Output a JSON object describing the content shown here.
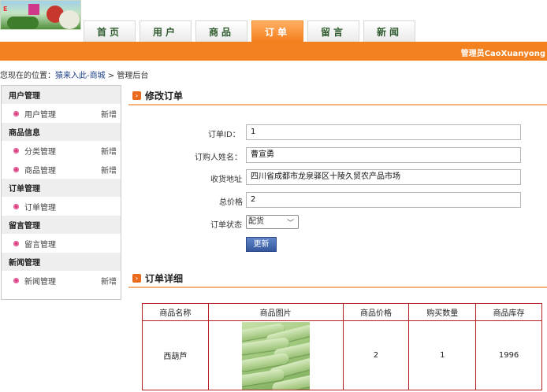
{
  "header": {
    "logo_icon": "vegetable-logo",
    "nav": [
      {
        "label": "首页",
        "active": false
      },
      {
        "label": "用户",
        "active": false
      },
      {
        "label": "商品",
        "active": false
      },
      {
        "label": "订单",
        "active": true
      },
      {
        "label": "留言",
        "active": false
      },
      {
        "label": "新闻",
        "active": false
      }
    ],
    "admin_text": "管理员CaoXuanyong",
    "accent_color": "#f4811f"
  },
  "breadcrumb": {
    "prefix": "您现在的位置：",
    "link": "猿来入此-商城",
    "separator": " > ",
    "current": "管理后台"
  },
  "sidebar": {
    "groups": [
      {
        "title": "用户管理",
        "items": [
          {
            "label": "用户管理",
            "extra": "新增"
          }
        ]
      },
      {
        "title": "商品信息",
        "items": [
          {
            "label": "分类管理",
            "extra": "新增"
          },
          {
            "label": "商品管理",
            "extra": "新增"
          }
        ]
      },
      {
        "title": "订单管理",
        "items": [
          {
            "label": "订单管理",
            "extra": ""
          }
        ]
      },
      {
        "title": "留言管理",
        "items": [
          {
            "label": "留言管理",
            "extra": ""
          }
        ]
      },
      {
        "title": "新闻管理",
        "items": [
          {
            "label": "新闻管理",
            "extra": "新增"
          }
        ]
      }
    ]
  },
  "edit": {
    "title": "修改订单",
    "fields": {
      "order_id": {
        "label": "订单ID：",
        "value": "1"
      },
      "buyer": {
        "label": "订购人姓名：",
        "value": "曹宣勇"
      },
      "address": {
        "label": "收货地址",
        "value": "四川省成都市龙泉驿区十陵久贸农产品市场"
      },
      "total": {
        "label": "总价格",
        "value": "2"
      },
      "status": {
        "label": "订单状态",
        "value": "配货"
      }
    },
    "update_label": "更新"
  },
  "detail": {
    "title": "订单详细",
    "columns": [
      "商品名称",
      "商品图片",
      "商品价格",
      "购买数量",
      "商品库存"
    ],
    "rows": [
      {
        "name": "西葫芦",
        "image_icon": "cucumber-photo",
        "price": "2",
        "qty": "1",
        "stock": "1996"
      }
    ]
  }
}
